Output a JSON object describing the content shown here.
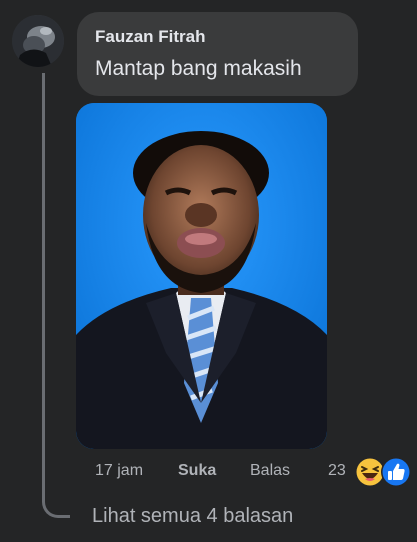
{
  "comment": {
    "author": "Fauzan Fitrah",
    "text": "Mantap bang makasih",
    "photo_alt": "photo",
    "time": "17 jam",
    "like_label": "Suka",
    "reply_label": "Balas",
    "reaction_count": "23",
    "reaction_icons": [
      "haha-icon",
      "like-icon"
    ]
  },
  "thread": {
    "see_all_label": "Lihat semua 4 balasan"
  },
  "colors": {
    "background": "#242526",
    "bubble": "#3a3b3c",
    "text_primary": "#e4e6eb",
    "text_secondary": "#b0b3b8",
    "photo_background": "#0b7be0",
    "like_blue": "#1877f2"
  }
}
